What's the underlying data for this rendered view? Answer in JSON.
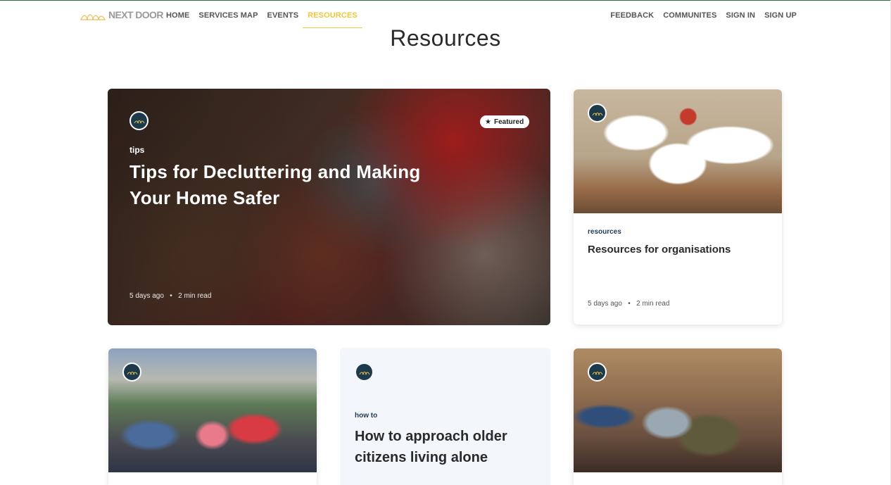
{
  "brand": {
    "name": "NEXT DOOR",
    "logo_icon": "arches-logo-icon"
  },
  "nav": {
    "left": [
      "HOME",
      "SERVICES MAP",
      "EVENTS",
      "RESOURCES"
    ],
    "active": "RESOURCES",
    "right": [
      "FEEDBACK",
      "COMMUNITES",
      "SIGN IN",
      "SIGN UP"
    ]
  },
  "page": {
    "title": "Resources"
  },
  "featured": {
    "badge": "Featured",
    "tag": "tips",
    "title": "Tips for Decluttering and Making Your Home Safer",
    "meta_time": "5 days ago",
    "meta_sep": "•",
    "meta_read": "2 min read"
  },
  "cards": [
    {
      "tag": "resources",
      "title": "Resources for organisations",
      "meta_time": "5 days ago",
      "meta_sep": "•",
      "meta_read": "2 min read"
    },
    {},
    {
      "tag": "how to",
      "title": "How to approach older citizens living alone"
    },
    {}
  ],
  "colors": {
    "accent": "#f0c63a",
    "tag_blue": "#1e3a57",
    "avatar_bg": "#1d3a4a",
    "card_soft_bg": "#f3f6fb"
  }
}
